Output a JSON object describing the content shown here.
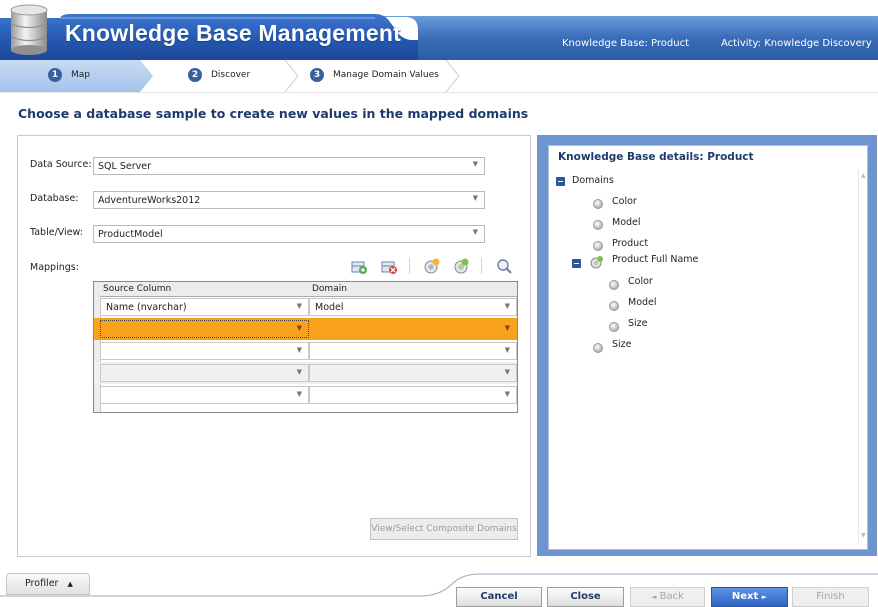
{
  "header": {
    "title": "Knowledge Base Management",
    "knowledge_base": "Knowledge Base: Product",
    "activity": "Activity: Knowledge Discovery",
    "icon": "database-icon"
  },
  "steps": [
    {
      "num": "1",
      "label": "Map",
      "active": true
    },
    {
      "num": "2",
      "label": "Discover",
      "active": false
    },
    {
      "num": "3",
      "label": "Manage Domain Values",
      "active": false
    }
  ],
  "page_title": "Choose a database sample to create new values in the mapped domains",
  "form": {
    "data_source": {
      "label": "Data Source:",
      "value": "SQL Server"
    },
    "database": {
      "label": "Database:",
      "value": "AdventureWorks2012"
    },
    "table_view": {
      "label": "Table/View:",
      "value": "ProductModel"
    },
    "mappings_label": "Mappings:"
  },
  "toolbar_icons": [
    "add-mapping-icon",
    "remove-mapping-icon",
    "create-domain-icon",
    "create-composite-domain-icon",
    "preview-icon"
  ],
  "grid": {
    "columns": [
      "Source Column",
      "Domain"
    ],
    "rows": [
      {
        "source": "Name (nvarchar)",
        "domain": "Model",
        "selected": false
      },
      {
        "source": "",
        "domain": "",
        "selected": true
      },
      {
        "source": "",
        "domain": "",
        "selected": false
      },
      {
        "source": "",
        "domain": "",
        "selected": false
      },
      {
        "source": "",
        "domain": "",
        "selected": false
      }
    ]
  },
  "composite_button": "View/Select Composite Domains",
  "kb_details": {
    "title": "Knowledge Base details: Product",
    "root": "Domains",
    "items": [
      "Color",
      "Model",
      "Product",
      "Product Full Name",
      "Size"
    ],
    "composite_children": [
      "Color",
      "Model",
      "Size"
    ]
  },
  "bottom": {
    "profiler": "Profiler",
    "cancel": "Cancel",
    "close": "Close",
    "back": "Back",
    "next": "Next",
    "finish": "Finish"
  },
  "colors": {
    "header_blue": "#3a6cb8",
    "selected_row": "#f9a21d",
    "title_navy": "#1f3b6b",
    "panel_blue": "#6f95cf",
    "next_button": "#2d64c6"
  }
}
